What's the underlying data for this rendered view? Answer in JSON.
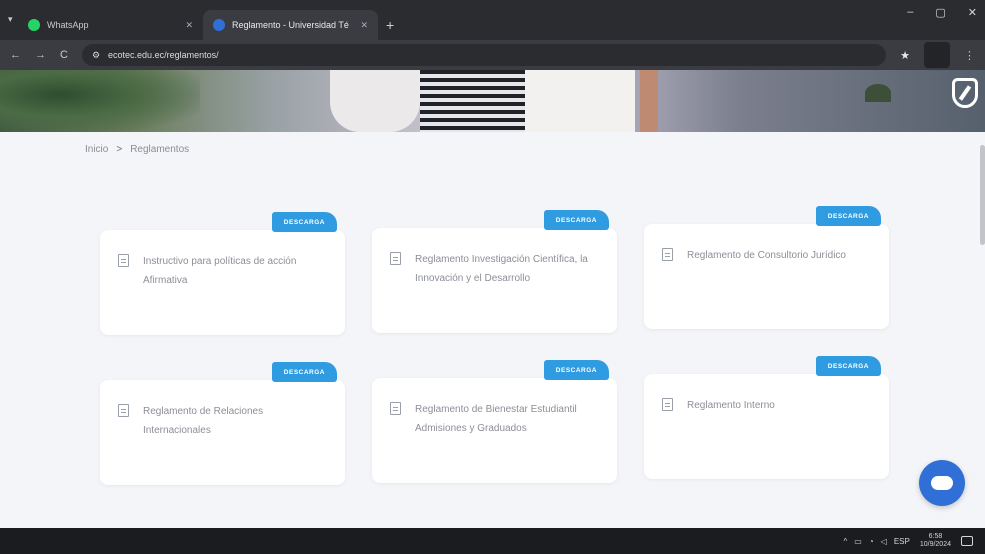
{
  "browser": {
    "tabs": [
      {
        "title": "WhatsApp",
        "active": false,
        "favicon_color": "#25d366"
      },
      {
        "title": "Reglamento - Universidad Té",
        "active": true,
        "favicon_color": "#2f6fd6"
      }
    ],
    "tab_close": "✕",
    "new_tab": "+",
    "url": "ecotec.edu.ec/reglamentos/",
    "nav": {
      "back": "←",
      "forward": "→",
      "reload": "C"
    },
    "window_controls": {
      "minimize": "–",
      "maximize": "▢",
      "close": "✕"
    }
  },
  "breadcrumb": {
    "home": "Inicio",
    "separator": ">",
    "current": "Reglamentos"
  },
  "cards": [
    {
      "badge": "DESCARGA",
      "title": "Instructivo para políticas de acción Afirmativa"
    },
    {
      "badge": "DESCARGA",
      "title": "Reglamento Investigación Científica, la Innovación y el Desarrollo"
    },
    {
      "badge": "DESCARGA",
      "title": "Reglamento de Consultorio Jurídico"
    },
    {
      "badge": "DESCARGA",
      "title": "Reglamento de Relaciones Internacionales"
    },
    {
      "badge": "DESCARGA",
      "title": "Reglamento de Bienestar Estudiantil Admisiones y Graduados"
    },
    {
      "badge": "DESCARGA",
      "title": "Reglamento Interno"
    }
  ],
  "taskbar": {
    "language": "ESP",
    "time": "6:58",
    "date": "10/9/2024"
  },
  "colors": {
    "accent": "#2f9be0",
    "chat_button": "#2f6fd6"
  }
}
